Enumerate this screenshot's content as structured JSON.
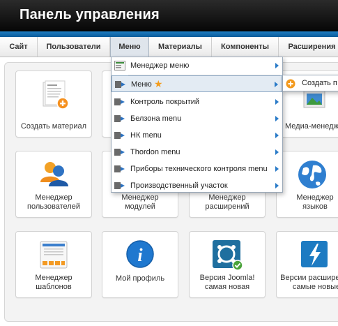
{
  "header": {
    "title": "Панель управления"
  },
  "menubar": {
    "items": [
      {
        "label": "Сайт"
      },
      {
        "label": "Пользователи"
      },
      {
        "label": "Меню"
      },
      {
        "label": "Материалы"
      },
      {
        "label": "Компоненты"
      },
      {
        "label": "Расширения"
      }
    ]
  },
  "dropdown": {
    "items": [
      {
        "label": "Менеджер меню"
      },
      {
        "label": "Меню"
      },
      {
        "label": "Контроль покрытий"
      },
      {
        "label": "Белзона menu"
      },
      {
        "label": "НК menu"
      },
      {
        "label": "Thordon menu"
      },
      {
        "label": "Приборы технического контроля menu"
      },
      {
        "label": "Производственный участок"
      }
    ]
  },
  "submenu": {
    "label": "Создать п"
  },
  "cards": [
    {
      "label": "Создать материал"
    },
    {
      "label": "Медиа-менеджер"
    },
    {
      "label": "Менеджер\nпользователей"
    },
    {
      "label": "Менеджер\nмодулей"
    },
    {
      "label": "Менеджер\nрасширений"
    },
    {
      "label": "Менеджер\nязыков"
    },
    {
      "label": "Менеджер\nшаблонов"
    },
    {
      "label": "Мой профиль"
    },
    {
      "label": "Версия Joomla!\nсамая новая"
    },
    {
      "label": "Версии расширений\nсамые новые"
    }
  ]
}
